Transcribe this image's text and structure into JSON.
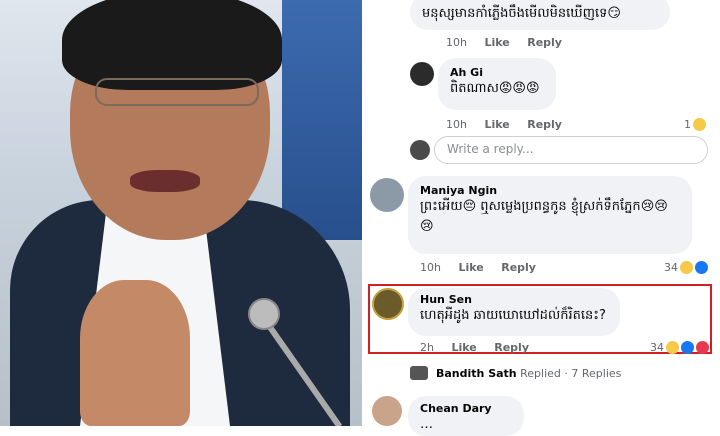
{
  "comments": [
    {
      "text": "មនុស្សមានកាំភ្លើងចឹងមើលមិនឃើញទេ😏",
      "time": "10h",
      "like": "Like",
      "reply": "Reply"
    },
    {
      "name": "Ah Gi",
      "text": "ពិតណាស😡😡😡",
      "time": "10h",
      "like": "Like",
      "reply": "Reply",
      "reactions": "1"
    },
    {
      "name": "Maniya Ngin",
      "text": "ព្រះអើយ😔 ឮសម្លេងប្រពន្ធកូន ខ្ញុំស្រក់ទឹកភ្នែក😢😢",
      "text2": "😢",
      "time": "10h",
      "like": "Like",
      "reply": "Reply",
      "reactions": "34"
    },
    {
      "name": "Hun Sen",
      "text": "ហេតុអីដូង ឆាយឃោឃៅដល់ក៏រិតនេះ?",
      "time": "2h",
      "like": "Like",
      "reply": "Reply",
      "reactions": "34"
    },
    {
      "name": "Chean Dary",
      "text": "…"
    }
  ],
  "reply_input": {
    "placeholder": "Write a reply..."
  },
  "replies_summary": {
    "name": "Bandith Sath",
    "label": "Replied · 7 Replies"
  },
  "colors": {
    "accent": "#1877f2",
    "highlight": "#d21f26"
  }
}
